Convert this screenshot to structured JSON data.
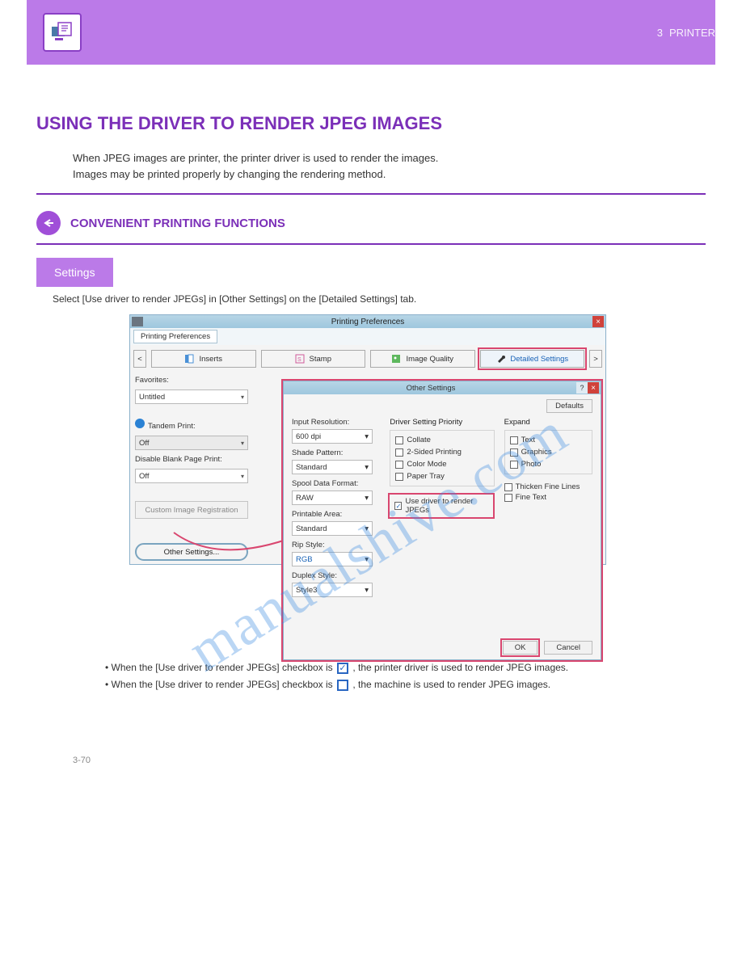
{
  "header": {
    "chapter_num": "3",
    "chapter_title": "PRINTER"
  },
  "section": {
    "title": "USING THE DRIVER TO RENDER JPEG IMAGES",
    "back_crumb": "CONVENIENT PRINTING FUNCTIONS"
  },
  "intro": {
    "p1": "When JPEG images are printer, the printer driver is used to render the images.",
    "p2": "Images may be printed properly by changing the rendering method.",
    "settings_label": "Settings",
    "hint": "Select [Use driver to render JPEGs] in [Other Settings] on the [Detailed Settings] tab."
  },
  "main_window": {
    "title": "Printing Preferences",
    "tab_label_inside": "Printing Preferences",
    "nav_prev": "<",
    "nav_next": ">",
    "tabs": [
      {
        "label": "Inserts"
      },
      {
        "label": "Stamp"
      },
      {
        "label": "Image Quality"
      },
      {
        "label": "Detailed Settings"
      }
    ],
    "favorites_label": "Favorites:",
    "favorites_value": "Untitled",
    "tandem_label": "Tandem Print:",
    "tandem_value": "Off",
    "disable_blank_label": "Disable Blank Page Print:",
    "disable_blank_value": "Off",
    "custom_reg_btn": "Custom Image Registration",
    "other_settings_btn": "Other Settings..."
  },
  "sub_window": {
    "title": "Other Settings",
    "defaults_btn": "Defaults",
    "col1": {
      "input_res_label": "Input Resolution:",
      "input_res_value": "600 dpi",
      "shade_label": "Shade Pattern:",
      "shade_value": "Standard",
      "spool_label": "Spool Data Format:",
      "spool_value": "RAW",
      "printable_label": "Printable Area:",
      "printable_value": "Standard",
      "rip_label": "Rip Style:",
      "rip_value": "RGB",
      "duplex_label": "Duplex Style:",
      "duplex_value": "Style3"
    },
    "col2": {
      "title": "Driver Setting Priority",
      "items": [
        "Collate",
        "2-Sided Printing",
        "Color Mode",
        "Paper Tray"
      ],
      "jpeg_checkbox": "Use driver to render JPEGs"
    },
    "col3": {
      "expand_title": "Expand",
      "expand_items": [
        "Text",
        "Graphics",
        "Photo"
      ],
      "thicken": "Thicken Fine Lines",
      "fine_text": "Fine Text"
    },
    "ok_btn": "OK",
    "cancel_btn": "Cancel"
  },
  "explain": {
    "l1": "When the [Use driver to render JPEGs] checkbox is ",
    "l1b": ", the printer driver is used to render JPEG images.",
    "l2": "When the [Use driver to render JPEGs] checkbox is ",
    "l2b": ", the machine is used to render JPEG images."
  },
  "page_number": "3-70",
  "watermark": "manualshive.com"
}
